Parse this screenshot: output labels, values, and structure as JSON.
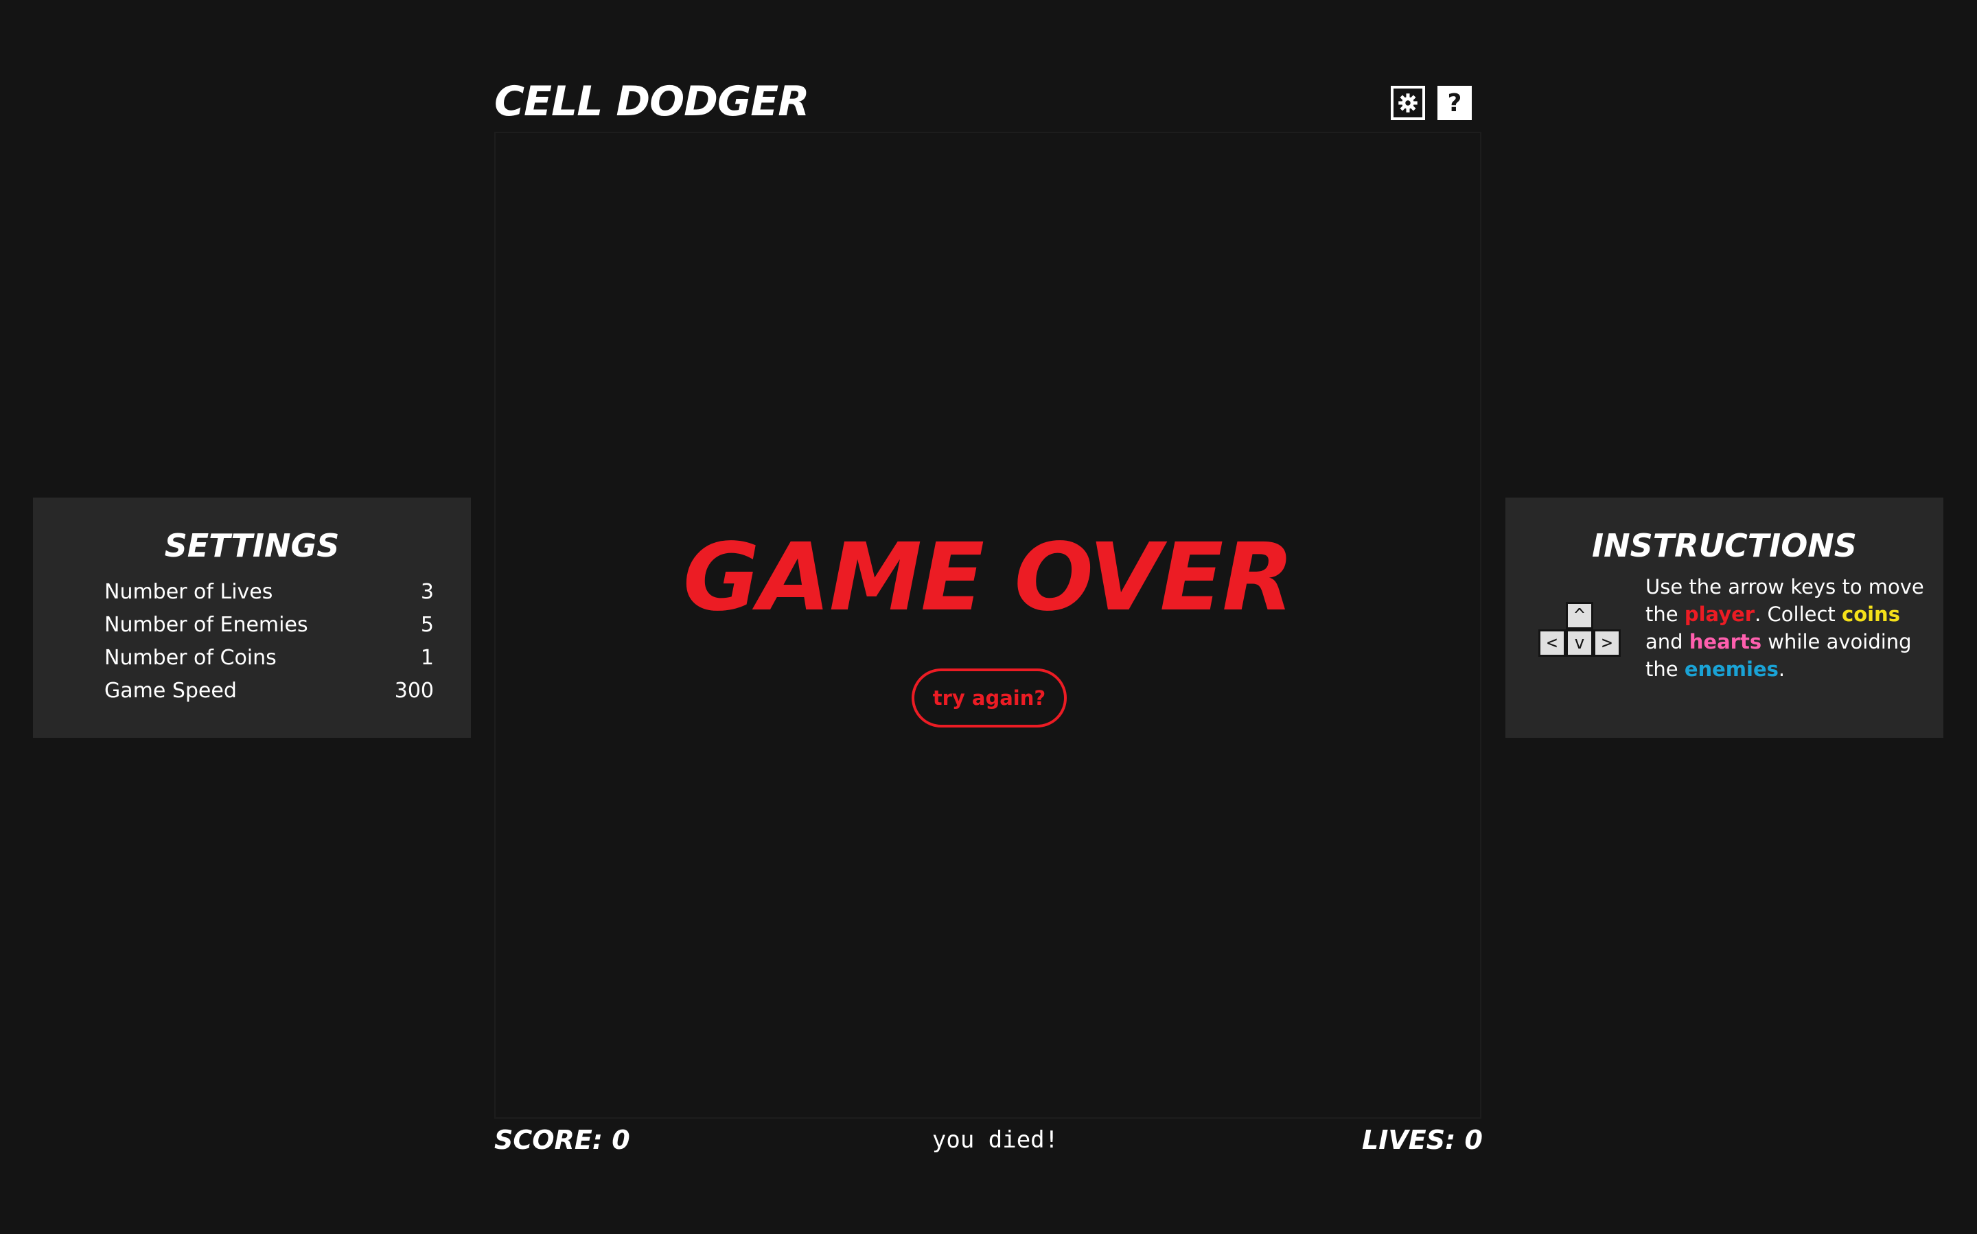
{
  "header": {
    "title": "CELL DODGER",
    "settings_icon": "gear-icon",
    "help_label": "?"
  },
  "board": {
    "headline": "GAME OVER",
    "retry_label": "try again?"
  },
  "status": {
    "score": "SCORE: 0",
    "message": "you died!",
    "lives": "LIVES: 0"
  },
  "settings": {
    "title": "SETTINGS",
    "items": [
      {
        "label": "Number of Lives",
        "value": "3"
      },
      {
        "label": "Number of Enemies",
        "value": "5"
      },
      {
        "label": "Number of Coins",
        "value": "1"
      },
      {
        "label": "Game Speed",
        "value": "300"
      }
    ]
  },
  "instructions": {
    "title": "INSTRUCTIONS",
    "keys": {
      "up": "^",
      "left": "<",
      "down": "v",
      "right": ">"
    },
    "text_1": "Use the arrow keys to move the ",
    "player_word": "player",
    "text_2": ". Collect ",
    "coins_word": "coins",
    "text_3": " and ",
    "hearts_word": "hearts",
    "text_4": " while avoiding the ",
    "enemies_word": "enemies",
    "text_5": "."
  },
  "colors": {
    "background": "#141414",
    "panel": "#282828",
    "accent_red": "#ec1c24",
    "player": "#ec1c24",
    "coins": "#f5e11a",
    "hearts": "#ff5fae",
    "enemies": "#1aa3d6",
    "text": "#ffffff"
  }
}
